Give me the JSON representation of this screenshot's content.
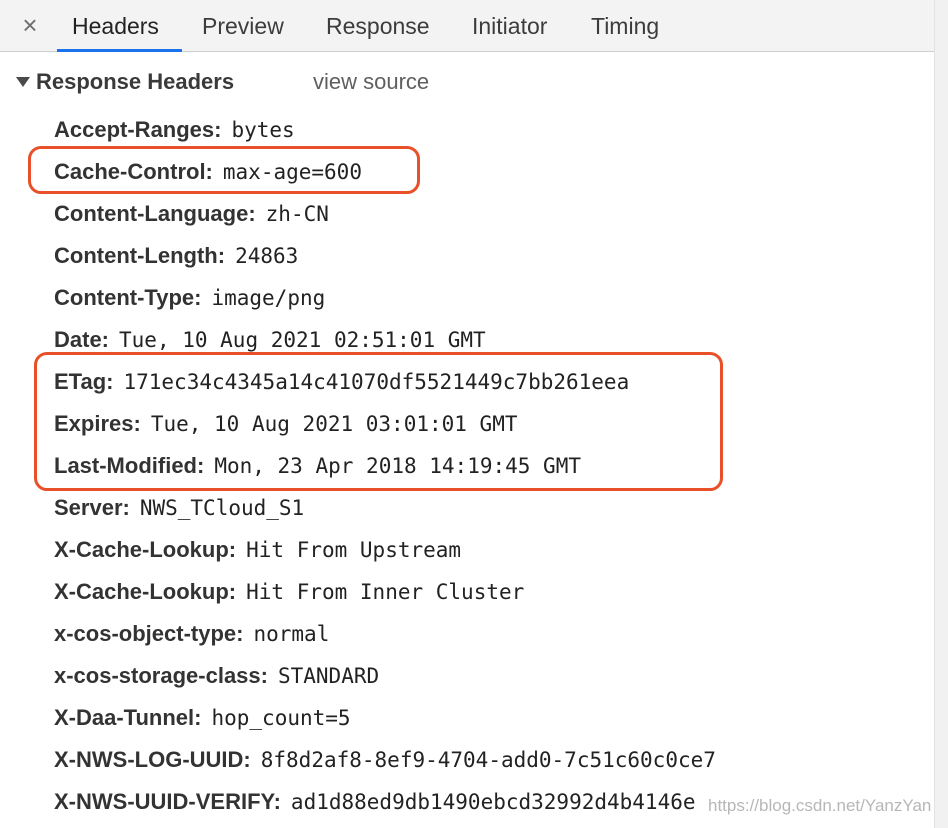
{
  "tabs": {
    "close_glyph": "×",
    "items": [
      "Headers",
      "Preview",
      "Response",
      "Initiator",
      "Timing"
    ],
    "active": "Headers"
  },
  "section": {
    "title": "Response Headers",
    "view_source": "view source"
  },
  "headers": [
    {
      "name": "Accept-Ranges:",
      "value": "bytes"
    },
    {
      "name": "Cache-Control:",
      "value": "max-age=600"
    },
    {
      "name": "Content-Language:",
      "value": "zh-CN"
    },
    {
      "name": "Content-Length:",
      "value": "24863"
    },
    {
      "name": "Content-Type:",
      "value": "image/png"
    },
    {
      "name": "Date:",
      "value": "Tue, 10 Aug 2021 02:51:01 GMT"
    },
    {
      "name": "ETag:",
      "value": "171ec34c4345a14c41070df5521449c7bb261eea"
    },
    {
      "name": "Expires:",
      "value": "Tue, 10 Aug 2021 03:01:01 GMT"
    },
    {
      "name": "Last-Modified:",
      "value": "Mon, 23 Apr 2018 14:19:45 GMT"
    },
    {
      "name": "Server:",
      "value": "NWS_TCloud_S1"
    },
    {
      "name": "X-Cache-Lookup:",
      "value": "Hit From Upstream"
    },
    {
      "name": "X-Cache-Lookup:",
      "value": "Hit From Inner Cluster"
    },
    {
      "name": "x-cos-object-type:",
      "value": "normal"
    },
    {
      "name": "x-cos-storage-class:",
      "value": "STANDARD"
    },
    {
      "name": "X-Daa-Tunnel:",
      "value": "hop_count=5"
    },
    {
      "name": "X-NWS-LOG-UUID:",
      "value": "8f8d2af8-8ef9-4704-add0-7c51c60c0ce7"
    },
    {
      "name": "X-NWS-UUID-VERIFY:",
      "value": "ad1d88ed9db1490ebcd32992d4b4146e"
    }
  ],
  "watermark": "https://blog.csdn.net/YanzYan",
  "colors": {
    "highlight": "#e8502a",
    "active_tab_underline": "#1a73e8"
  }
}
